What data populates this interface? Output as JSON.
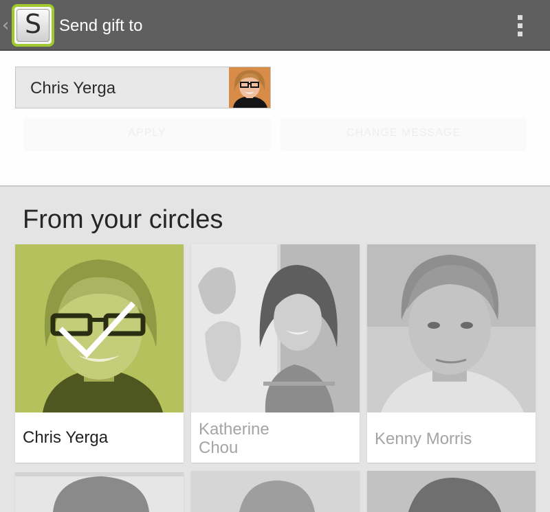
{
  "header": {
    "title": "Send gift to",
    "app_icon_letter": "S",
    "accent_color": "#9fc92c"
  },
  "recipient": {
    "name": "Chris Yerga",
    "button_left": "APPLY",
    "button_right": "CHANGE MESSAGE"
  },
  "circles": {
    "title": "From your circles",
    "people": [
      {
        "name": "Chris Yerga",
        "selected": true
      },
      {
        "name_line1": "Katherine",
        "name_line2": "Chou",
        "selected": false
      },
      {
        "name": "Kenny Morris",
        "selected": false
      }
    ]
  },
  "icons": [
    "back-chevron-icon",
    "overflow-menu-icon",
    "check-icon"
  ]
}
